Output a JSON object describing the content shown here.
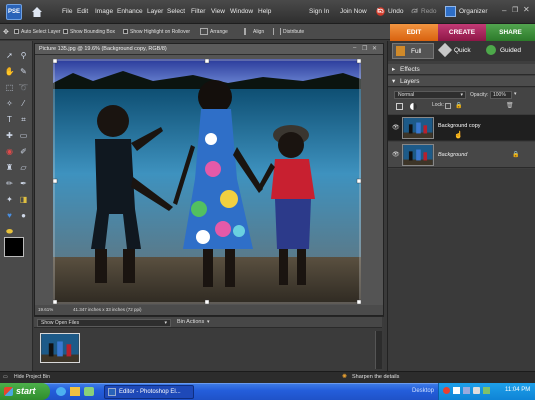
{
  "app": {
    "logo_text": "PSE",
    "home_icon": "home-icon"
  },
  "menu": [
    "File",
    "Edit",
    "Image",
    "Enhance",
    "Layer",
    "Select",
    "Filter",
    "View",
    "Window",
    "Help"
  ],
  "account": {
    "sign_in": "Sign In",
    "join_now": "Join Now"
  },
  "history": {
    "undo": "Undo",
    "redo": "Redo"
  },
  "organizer": "Organizer",
  "options_bar": {
    "auto_select": "Auto Select Layer",
    "bounding_box": "Show Bounding Box",
    "highlight": "Show Highlight on Rollover",
    "arrange": "Arrange",
    "align": "Align",
    "distribute": "Distribute"
  },
  "mode_tabs": [
    {
      "label": "EDIT",
      "color": "#e8731e"
    },
    {
      "label": "CREATE",
      "color": "#a8205a"
    },
    {
      "label": "SHARE",
      "color": "#3b8a3a"
    }
  ],
  "edit_subtabs": [
    "Full",
    "Quick",
    "Guided"
  ],
  "document": {
    "title": "Picture 135.jpg @ 19.6% (Background copy, RGB/8)",
    "zoom": "19.61%",
    "size_info": "41.347 inches x 33 inches (72 ppi)"
  },
  "bin": {
    "dropdown": "Show Open Files",
    "actions": "Bin Actions",
    "hide_label": "Hide Project Bin"
  },
  "panels": {
    "effects": "Effects",
    "layers": "Layers",
    "blend_mode": "Normal",
    "opacity_label": "Opacity:",
    "opacity_value": "100%",
    "lock_label": "Lock:",
    "layers_list": [
      {
        "name": "Background copy",
        "selected": true
      },
      {
        "name": "Background",
        "locked": true
      }
    ]
  },
  "status_tip": "Sharpen the details",
  "taskbar": {
    "start": "start",
    "task": "Editor - Photoshop El...",
    "desktop": "Desktop",
    "clock": "11:04 PM"
  },
  "colors": {
    "edit_tab": "#e8731e",
    "create_tab": "#a8205a",
    "share_tab": "#3b8a3a",
    "xp_taskbar": "#245edb"
  }
}
